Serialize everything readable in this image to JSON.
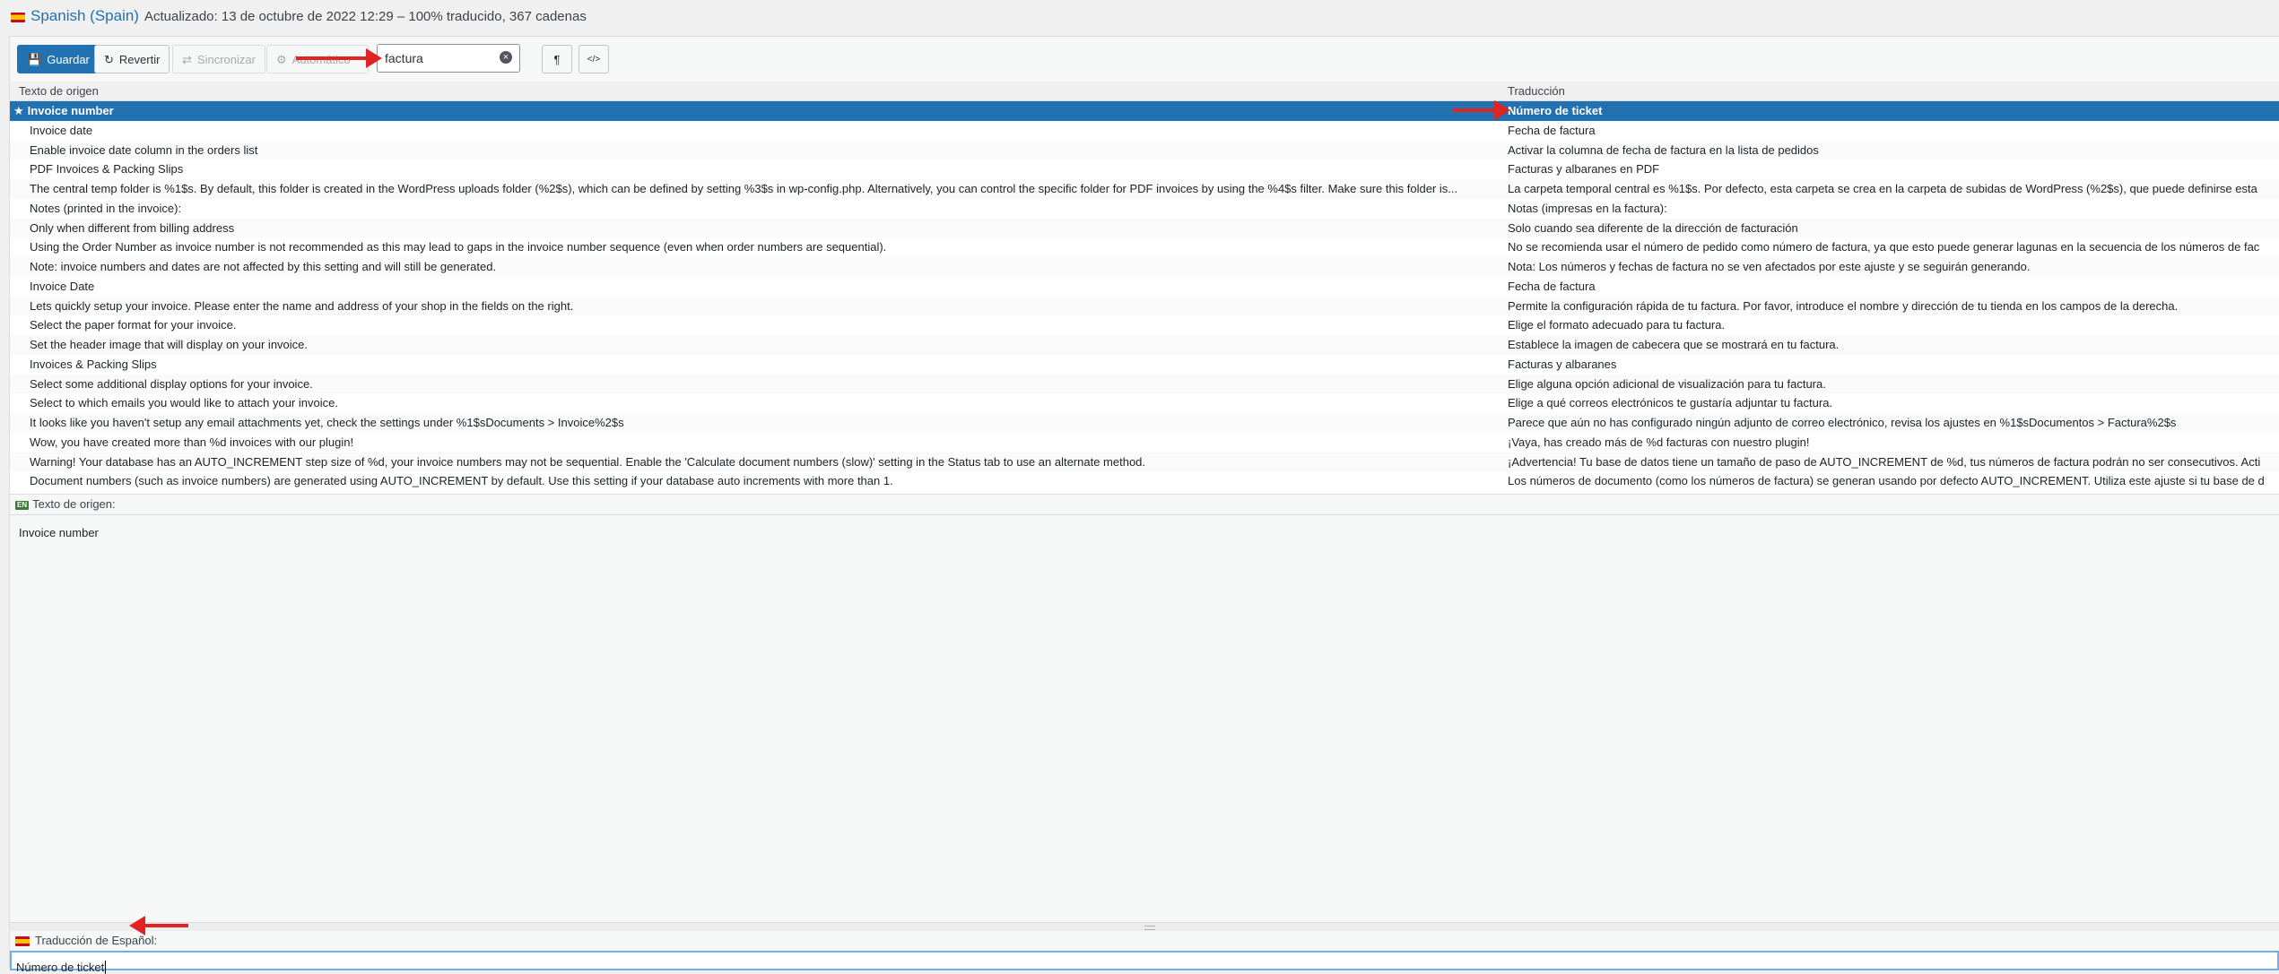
{
  "header": {
    "language": "Spanish (Spain)",
    "meta": "Actualizado: 13 de octubre de 2022 12:29 – 100% traducido, 367 cadenas"
  },
  "toolbar": {
    "save": "Guardar",
    "revert": "Revertir",
    "sync": "Sincronizar",
    "auto": "Automático",
    "search_value": "factura",
    "pilcrow": "¶",
    "code": "</>"
  },
  "table": {
    "col_source": "Texto de origen",
    "col_translation": "Traducción",
    "rows": [
      {
        "src": "Invoice number",
        "tr": "Número de ticket"
      },
      {
        "src": "Invoice date",
        "tr": "Fecha de factura"
      },
      {
        "src": "Enable invoice date column in the orders list",
        "tr": "Activar la columna de fecha de factura en la lista de pedidos"
      },
      {
        "src": "PDF Invoices & Packing Slips",
        "tr": "Facturas y albaranes en PDF"
      },
      {
        "src": "The central temp folder is %1$s. By default, this folder is created in the WordPress uploads folder (%2$s), which can be defined by setting %3$s in wp-config.php. Alternatively, you can control the specific folder for PDF invoices by using the %4$s filter. Make sure this folder is...",
        "tr": "La carpeta temporal central es %1$s. Por defecto, esta carpeta se crea en la carpeta de subidas de WordPress (%2$s), que puede definirse esta"
      },
      {
        "src": "Notes (printed in the invoice):",
        "tr": "Notas (impresas en la factura):"
      },
      {
        "src": "Only when different from billing address",
        "tr": "Solo cuando sea diferente de la dirección de facturación"
      },
      {
        "src": "Using the Order Number as invoice number is not recommended as this may lead to gaps in the invoice number sequence (even when order numbers are sequential).",
        "tr": "No se recomienda usar el número de pedido como número de factura, ya que esto puede generar lagunas en la secuencia de los números de fac"
      },
      {
        "src": "Note: invoice numbers and dates are not affected by this setting and will still be generated.",
        "tr": "Nota: Los números y fechas de factura no se ven afectados por este ajuste y se seguirán generando."
      },
      {
        "src": "Invoice Date",
        "tr": "Fecha de factura"
      },
      {
        "src": "Lets quickly setup your invoice. Please enter the name and address of your shop in the fields on the right.",
        "tr": "Permite la configuración rápida de tu factura. Por favor, introduce el nombre y dirección de tu tienda en los campos de la derecha."
      },
      {
        "src": "Select the paper format for your invoice.",
        "tr": "Elige el formato adecuado para tu factura."
      },
      {
        "src": "Set the header image that will display on your invoice.",
        "tr": "Establece la imagen de cabecera que se mostrará en tu factura."
      },
      {
        "src": "Invoices & Packing Slips",
        "tr": "Facturas y albaranes"
      },
      {
        "src": "Select some additional display options for your invoice.",
        "tr": "Elige alguna opción adicional de visualización para tu factura."
      },
      {
        "src": "Select to which emails you would like to attach your invoice.",
        "tr": "Elige a qué correos electrónicos te gustaría adjuntar tu factura."
      },
      {
        "src": "It looks like you haven't setup any email attachments yet, check the settings under %1$sDocuments > Invoice%2$s",
        "tr": "Parece que aún no has configurado ningún adjunto de correo electrónico, revisa los ajustes en %1$sDocumentos > Factura%2$s"
      },
      {
        "src": "Wow, you have created more than %d invoices with our plugin!",
        "tr": "¡Vaya, has creado más de %d facturas con nuestro plugin!"
      },
      {
        "src": "Warning! Your database has an AUTO_INCREMENT step size of %d, your invoice numbers may not be sequential. Enable the 'Calculate document numbers (slow)' setting in the Status tab to use an alternate method.",
        "tr": "¡Advertencia! Tu base de datos tiene un tamaño de paso de AUTO_INCREMENT de %d, tus números de factura podrán no ser consecutivos. Acti"
      },
      {
        "src": "Document numbers (such as invoice numbers) are generated using AUTO_INCREMENT by default. Use this setting if your database auto increments with more than 1.",
        "tr": "Los números de documento (como los números de factura) se generan usando por defecto AUTO_INCREMENT. Utiliza este ajuste si tu base de d"
      }
    ]
  },
  "source_pane": {
    "badge": "EN",
    "label": "Texto de origen:",
    "text": "Invoice number"
  },
  "translation_pane": {
    "label": "Traducción de Español:",
    "text": "Número de ticket"
  }
}
